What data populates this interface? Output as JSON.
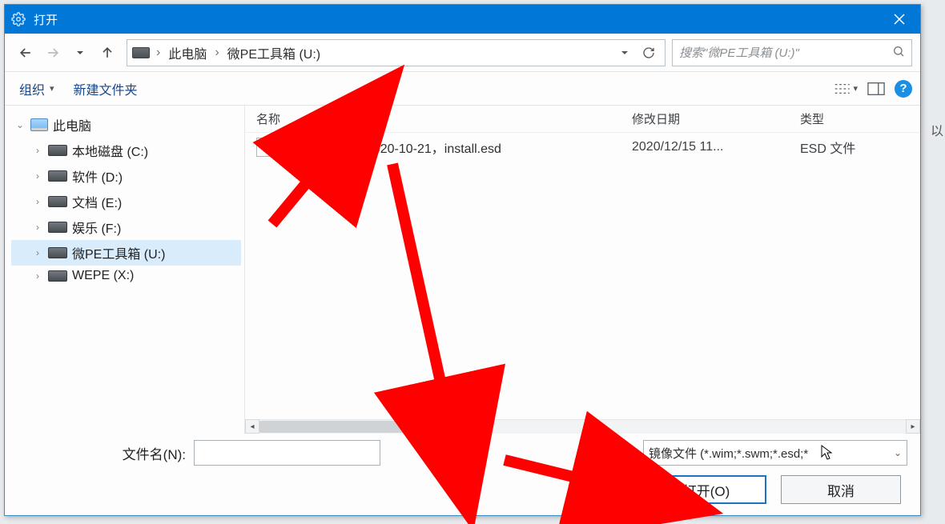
{
  "window": {
    "title": "打开"
  },
  "nav": {
    "crumbs": [
      "此电脑",
      "微PE工具箱 (U:)"
    ],
    "search_placeholder": "搜索\"微PE工具箱 (U:)\""
  },
  "toolbar": {
    "organize": "组织",
    "newfolder": "新建文件夹"
  },
  "tree": {
    "root": "此电脑",
    "drives": [
      {
        "label": "本地磁盘 (C:)",
        "selected": false
      },
      {
        "label": "软件 (D:)",
        "selected": false
      },
      {
        "label": "文档 (E:)",
        "selected": false
      },
      {
        "label": "娱乐 (F:)",
        "selected": false
      },
      {
        "label": "微PE工具箱 (U:)",
        "selected": true
      },
      {
        "label": "WEPE (X:)",
        "selected": false
      }
    ]
  },
  "columns": {
    "name": "名称",
    "date": "修改日期",
    "type": "类型"
  },
  "files": [
    {
      "name": "Win10-20H2，2020-10-21，install.esd",
      "date": "2020/12/15 11...",
      "type": "ESD 文件"
    }
  ],
  "bottom": {
    "filename_label": "文件名(N):",
    "filename_value": "",
    "filetype_label": "镜像文件 (*.wim;*.swm;*.esd;*",
    "open": "打开(O)",
    "cancel": "取消"
  },
  "edge_text": "以"
}
